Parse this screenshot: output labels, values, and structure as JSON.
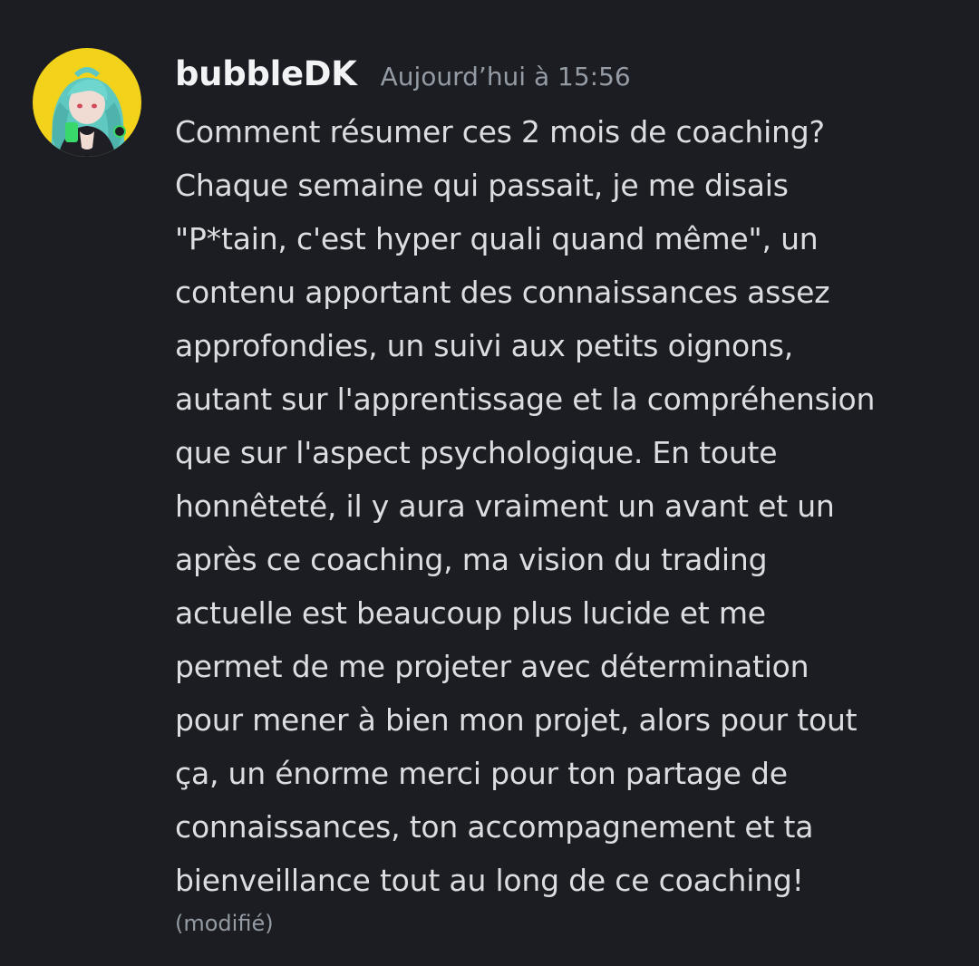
{
  "message": {
    "author": "bubbleDK",
    "timestamp": "Aujourd’hui à 15:56",
    "text": "Comment résumer ces 2 mois de coaching?\nChaque semaine qui passait, je me disais\n\"P*tain, c'est hyper quali quand même\", un\ncontenu apportant des connaissances assez\napprofondies, un suivi aux petits oignons,\nautant sur l'apprentissage et la compréhension\nque sur l'aspect psychologique. En toute\nhonnêteté, il y aura vraiment un avant et un\naprès ce coaching, ma vision du trading\nactuelle est beaucoup plus lucide et me\npermet de me projeter avec détermination\npour mener à bien mon projet, alors pour tout\nça, un énorme merci pour ton partage de\nconnaissances, ton accompagnement et ta\nbienveillance tout au long de ce coaching!",
    "edited_label": "(modifié)"
  },
  "colors": {
    "background": "#1c1d22",
    "username": "#f2f3f5",
    "timestamp": "#949ba4",
    "text": "#dbdee1",
    "avatar_bg": "#f2d21a"
  }
}
